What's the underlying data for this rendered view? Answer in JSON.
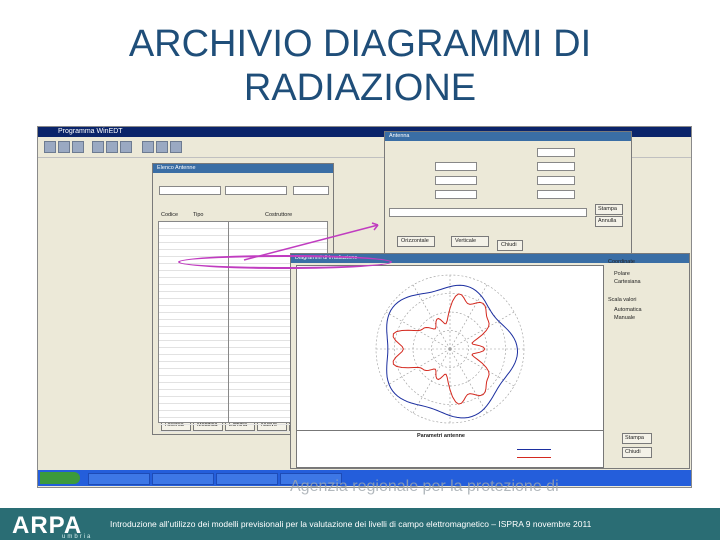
{
  "slide": {
    "title_line1": "ARCHIVIO DIAGRAMMI DI",
    "title_line2": "RADIAZIONE",
    "footer_text": "Introduzione all’utilizzo dei modelli previsionali per la valutazione dei livelli di campo elettromagnetico – ISPRA 9 novembre 2011",
    "logo_text": "ARPA",
    "logo_sub": "umbria",
    "watermark": "Agenzia regionale per la protezione di"
  },
  "app": {
    "window_title": "Programma WinEDT",
    "archive_window_title": "Elenco Antenne",
    "settings_window_title": "Antenna",
    "polar_window_title": "Diagrammi di irradiazione",
    "list_header_code": "Codice",
    "list_header_type": "Tipo",
    "list_header_producer": "Costruttore",
    "params_title": "Parametri antenne",
    "buttons": {
      "search": "Ricerca",
      "modify": "Modifica",
      "delete": "Elimina",
      "new": "Nuovo",
      "close": "Chiudi",
      "horizontal": "Orizzontale",
      "vertical": "Verticale",
      "print": "Stampa",
      "cancel": "Annulla"
    },
    "panel": {
      "group_label": "Coordinate",
      "polar": "Polare",
      "cartesian": "Cartesiana",
      "scale_group": "Scala valori",
      "auto": "Automatica",
      "manual": "Manuale"
    },
    "accent_color": "#3a6ea5",
    "highlight_color": "#c03cc0"
  },
  "list_rows": 30
}
